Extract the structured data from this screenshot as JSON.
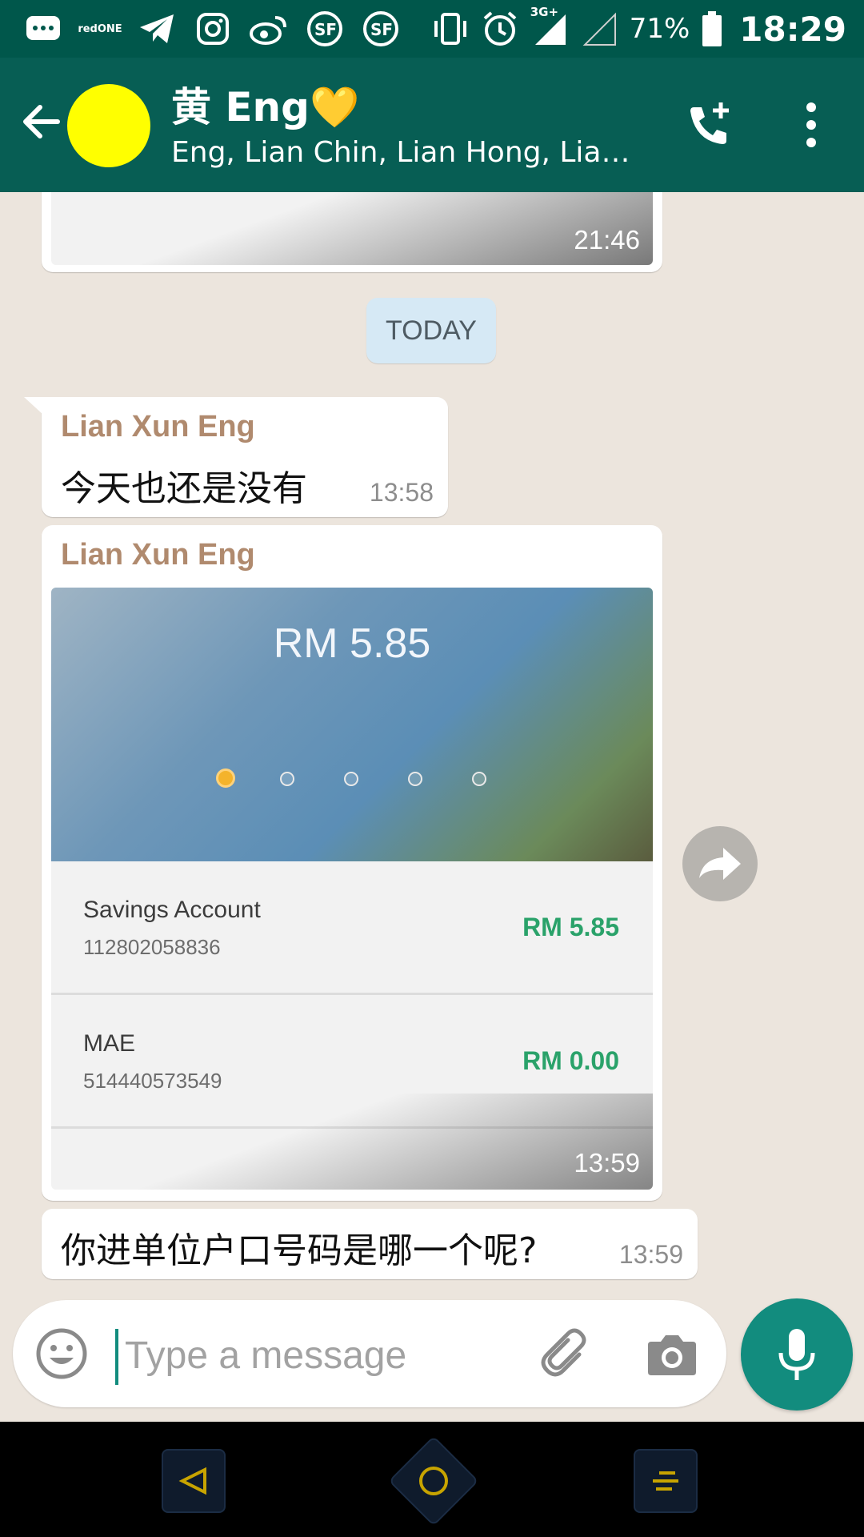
{
  "status_bar": {
    "icons": [
      "chat-bubble-icon",
      "redone-icon",
      "telegram-icon",
      "instagram-icon",
      "weibo-icon",
      "sf-express-icon",
      "sf-express-icon",
      "vibrate-icon",
      "alarm-icon",
      "signal-3g-icon",
      "signal-empty-icon",
      "battery-icon"
    ],
    "carrier_text": "redONE",
    "network_label": "3G+",
    "battery": "71%",
    "time": "18:29"
  },
  "header": {
    "title": "黄 Eng💛",
    "subtitle": "Eng, Lian Chin, Lian Hong, Lian K...",
    "avatar_color": "#ffff00"
  },
  "messages": {
    "prev_image_time": "21:46",
    "date_chip": "TODAY",
    "msg1": {
      "sender": "Lian Xun Eng",
      "text": "今天也还是没有",
      "time": "13:58"
    },
    "msg2": {
      "sender": "Lian Xun Eng",
      "time": "13:59",
      "image": {
        "balance": "RM 5.85",
        "accounts": [
          {
            "name": "Savings Account",
            "number": "112802058836",
            "amount": "RM 5.85"
          },
          {
            "name": "MAE",
            "number": "514440573549",
            "amount": "RM 0.00"
          }
        ]
      }
    },
    "msg3": {
      "text": "你进单位户口号码是哪一个呢?",
      "time": "13:59"
    }
  },
  "input": {
    "placeholder": "Type a message"
  },
  "colors": {
    "primary": "#075e54",
    "status_bar": "#00574b",
    "accent": "#128c7e",
    "sender_name": "#b08a6e",
    "amount_green": "#2aa26a"
  }
}
